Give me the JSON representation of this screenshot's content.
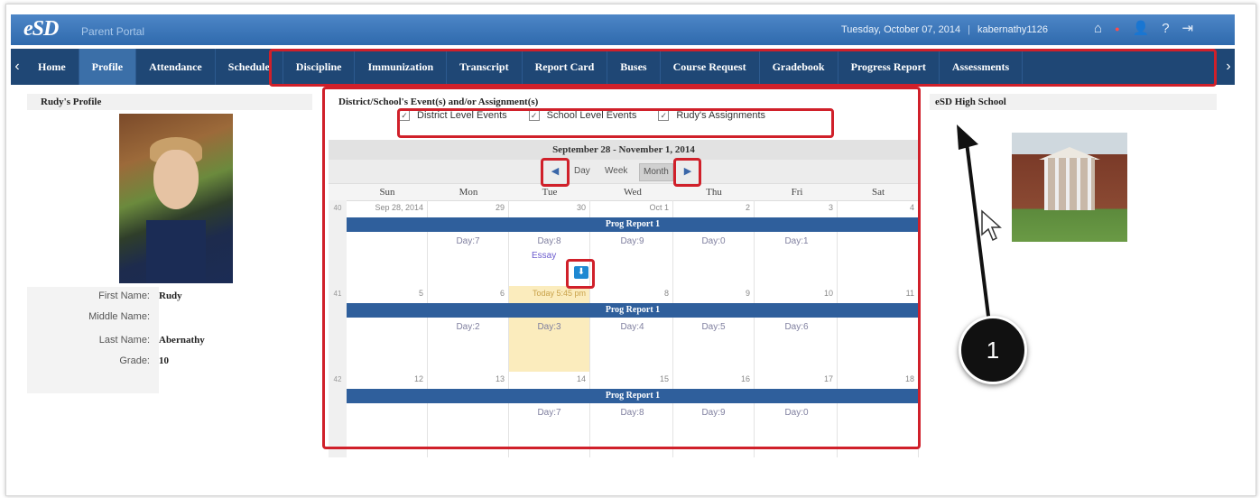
{
  "header": {
    "logo": "eSD",
    "logo_sub": "Parent Portal",
    "date": "Tuesday, October 07, 2014",
    "user": "kabernathy1126"
  },
  "nav": {
    "items": [
      {
        "label": "Home"
      },
      {
        "label": "Profile",
        "active": true
      },
      {
        "label": "Attendance"
      },
      {
        "label": "Schedule"
      },
      {
        "label": "Discipline"
      },
      {
        "label": "Immunization"
      },
      {
        "label": "Transcript"
      },
      {
        "label": "Report Card"
      },
      {
        "label": "Buses"
      },
      {
        "label": "Course Request"
      },
      {
        "label": "Gradebook"
      },
      {
        "label": "Progress Report"
      },
      {
        "label": "Assessments"
      }
    ]
  },
  "profile": {
    "title": "Rudy's Profile",
    "fields": [
      {
        "label": "First Name:",
        "value": "Rudy"
      },
      {
        "label": "Middle Name:",
        "value": ""
      },
      {
        "label": "Last Name:",
        "value": "Abernathy"
      },
      {
        "label": "Grade:",
        "value": "10"
      }
    ]
  },
  "events": {
    "title": "District/School's Event(s) and/or Assignment(s)",
    "filters": [
      "District Level Events",
      "School Level Events",
      "Rudy's Assignments"
    ]
  },
  "calendar": {
    "range": "September 28 - November 1, 2014",
    "views": [
      "Day",
      "Week",
      "Month"
    ],
    "days_of_week": [
      "Sun",
      "Mon",
      "Tue",
      "Wed",
      "Thu",
      "Fri",
      "Sat"
    ],
    "weeks": [
      {
        "num": "40",
        "event": "Prog Report 1",
        "dates": [
          "Sep 28, 2014",
          "29",
          "30",
          "Oct 1",
          "2",
          "3",
          "4"
        ],
        "labels": [
          "",
          "Day:7",
          "Day:8",
          "Day:9",
          "Day:0",
          "Day:1",
          ""
        ]
      },
      {
        "num": "41",
        "event": "Prog Report 1",
        "dates": [
          "5",
          "6",
          "Today 5:45 pm",
          "8",
          "9",
          "10",
          "11"
        ],
        "labels": [
          "",
          "Day:2",
          "Day:3",
          "Day:4",
          "Day:5",
          "Day:6",
          ""
        ]
      },
      {
        "num": "42",
        "event": "Prog Report 1",
        "dates": [
          "12",
          "13",
          "14",
          "15",
          "16",
          "17",
          "18"
        ],
        "labels": [
          "",
          "",
          "Day:7",
          "Day:8",
          "Day:9",
          "Day:0",
          ""
        ]
      }
    ],
    "assignment": "Essay"
  },
  "school": {
    "name": "eSD High School"
  },
  "annotation": {
    "step": "1"
  }
}
